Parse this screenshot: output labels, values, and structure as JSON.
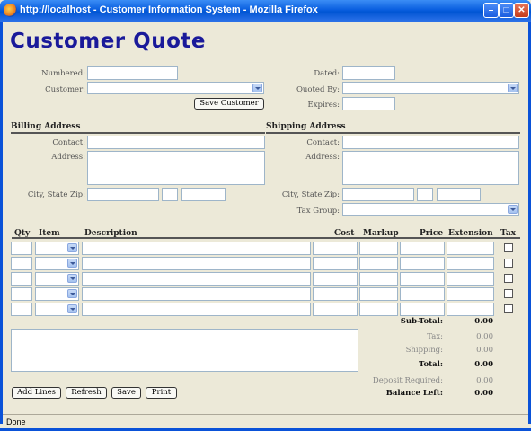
{
  "window": {
    "title": "http://localhost - Customer Information System - Mozilla Firefox",
    "status": "Done"
  },
  "page": {
    "heading": "Customer Quote"
  },
  "quote_fields": {
    "numbered_label": "Numbered:",
    "customer_label": "Customer:",
    "save_customer": "Save Customer",
    "dated_label": "Dated:",
    "quoted_by_label": "Quoted By:",
    "expires_label": "Expires:"
  },
  "billing": {
    "heading": "Billing Address",
    "contact_label": "Contact:",
    "address_label": "Address:",
    "city_state_zip_label": "City, State Zip:"
  },
  "shipping": {
    "heading": "Shipping Address",
    "contact_label": "Contact:",
    "address_label": "Address:",
    "city_state_zip_label": "City, State Zip:",
    "tax_group_label": "Tax Group:"
  },
  "lines_table": {
    "columns": [
      "Qty",
      "Item",
      "Description",
      "Cost",
      "Markup",
      "Price",
      "Extension",
      "Tax"
    ]
  },
  "totals": {
    "subtotal_label": "Sub-Total:",
    "subtotal_value": "0.00",
    "tax_label": "Tax:",
    "tax_value": "0.00",
    "shipping_label": "Shipping:",
    "shipping_value": "0.00",
    "total_label": "Total:",
    "total_value": "0.00",
    "deposit_label": "Deposit Required:",
    "deposit_value": "0.00",
    "balance_label": "Balance Left:",
    "balance_value": "0.00"
  },
  "actions": {
    "add_lines": "Add Lines",
    "refresh": "Refresh",
    "save": "Save",
    "print": "Print"
  },
  "colors": {
    "titlebar": "#0a5fe0",
    "heading": "#1a1a9a",
    "background": "#ece9d8"
  }
}
